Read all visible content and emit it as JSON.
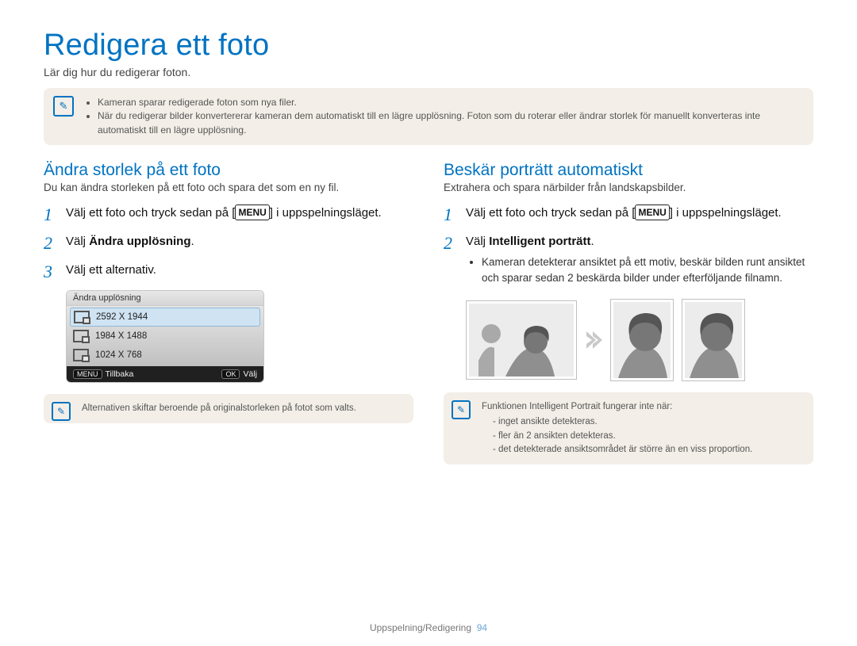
{
  "title": "Redigera ett foto",
  "subtitle": "Lär dig hur du redigerar foton.",
  "top_note": {
    "items": [
      "Kameran sparar redigerade foton som nya filer.",
      "När du redigerar bilder konvertererar kameran dem automatiskt till en lägre upplösning. Foton som du roterar eller ändrar storlek för manuellt konverteras inte automatiskt till en lägre upplösning."
    ]
  },
  "left": {
    "heading": "Ändra storlek på ett foto",
    "lead": "Du kan ändra storleken på ett foto och spara det som en ny fil.",
    "step1_prefix": "Välj ett foto och tryck sedan på [",
    "step1_menu": "MENU",
    "step1_suffix": "] i uppspelningsläget.",
    "step2_prefix": "Välj ",
    "step2_bold": "Ändra upplösning",
    "step2_suffix": ".",
    "step3": "Välj ett alternativ.",
    "lcd": {
      "header": "Ändra upplösning",
      "rows": [
        "2592 X 1944",
        "1984 X 1488",
        "1024 X 768"
      ],
      "back_label": "Tillbaka",
      "select_label": "Välj",
      "back_btn": "MENU",
      "ok_btn": "OK"
    },
    "note": "Alternativen skiftar beroende på originalstorleken på fotot som valts."
  },
  "right": {
    "heading": "Beskär porträtt automatiskt",
    "lead": "Extrahera och spara närbilder från landskapsbilder.",
    "step1_prefix": "Välj ett foto och tryck sedan på [",
    "step1_menu": "MENU",
    "step1_suffix": "] i uppspelningsläget.",
    "step2_prefix": "Välj ",
    "step2_bold": "Intelligent porträtt",
    "step2_suffix": ".",
    "bullet": "Kameran detekterar ansiktet på ett motiv, beskär bilden runt ansiktet och sparar sedan 2 beskärda bilder under efterföljande filnamn.",
    "note_title": "Funktionen Intelligent Portrait fungerar inte när:",
    "note_items": [
      "inget ansikte detekteras.",
      "fler än 2 ansikten detekteras.",
      "det detekterade ansiktsområdet är större än en viss proportion."
    ]
  },
  "footer": {
    "section": "Uppspelning/Redigering",
    "page": "94"
  }
}
